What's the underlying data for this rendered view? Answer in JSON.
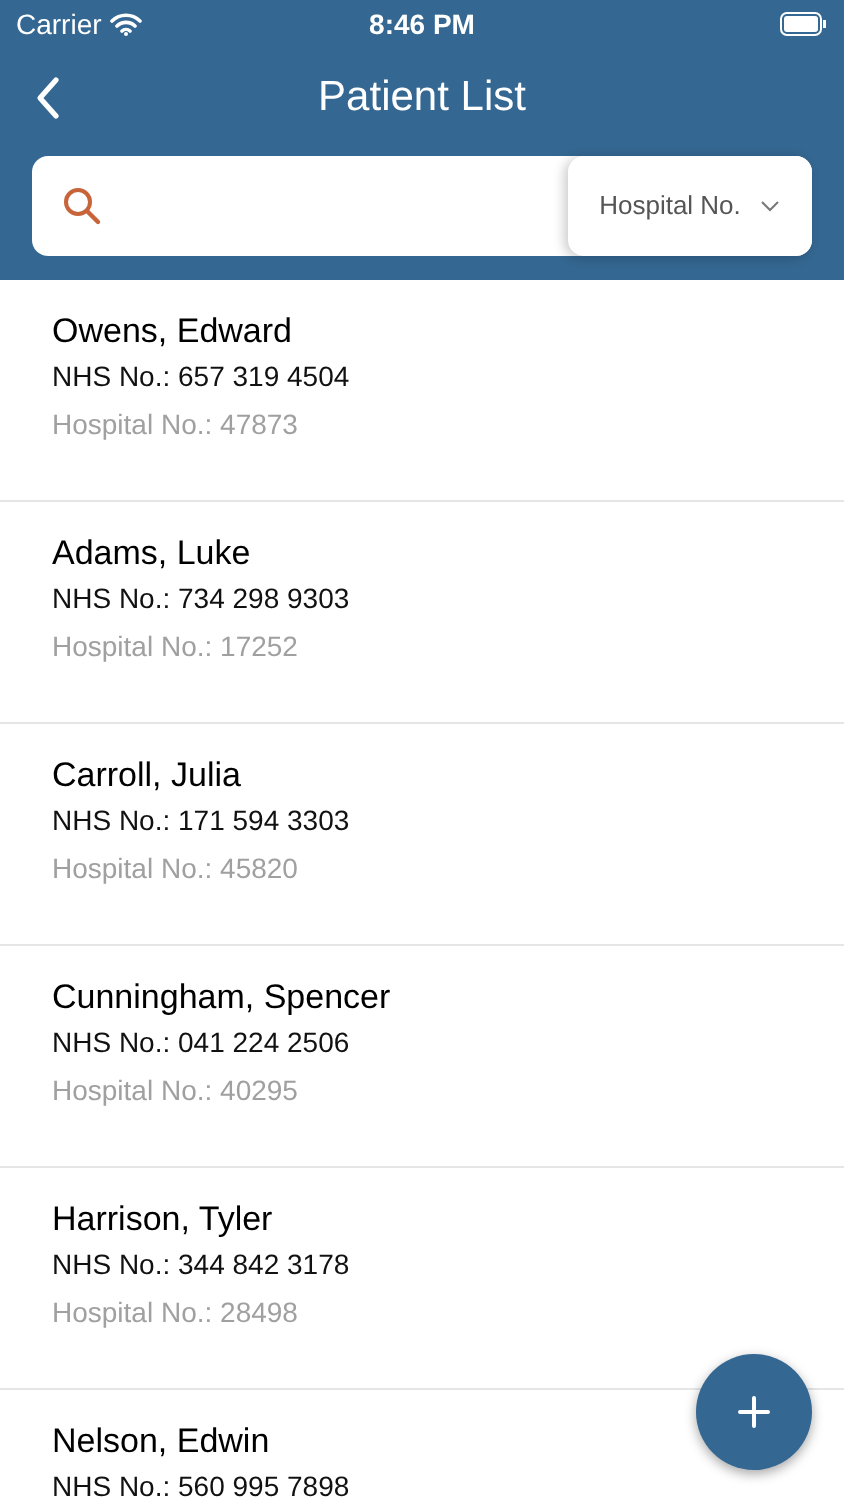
{
  "status_bar": {
    "carrier": "Carrier",
    "time": "8:46 PM"
  },
  "nav": {
    "title": "Patient List"
  },
  "search": {
    "filter": "Hospital No."
  },
  "patients": [
    {
      "name": "Owens, Edward",
      "nhs": "NHS No.: 657 319 4504",
      "hospital": "Hospital No.: 47873"
    },
    {
      "name": "Adams, Luke",
      "nhs": "NHS No.: 734 298 9303",
      "hospital": "Hospital No.: 17252"
    },
    {
      "name": "Carroll, Julia",
      "nhs": "NHS No.: 171 594 3303",
      "hospital": "Hospital No.: 45820"
    },
    {
      "name": "Cunningham, Spencer",
      "nhs": "NHS No.: 041 224 2506",
      "hospital": "Hospital No.: 40295"
    },
    {
      "name": "Harrison, Tyler",
      "nhs": "NHS No.: 344 842 3178",
      "hospital": "Hospital No.: 28498"
    },
    {
      "name": "Nelson, Edwin",
      "nhs": "NHS No.: 560 995 7898"
    }
  ]
}
